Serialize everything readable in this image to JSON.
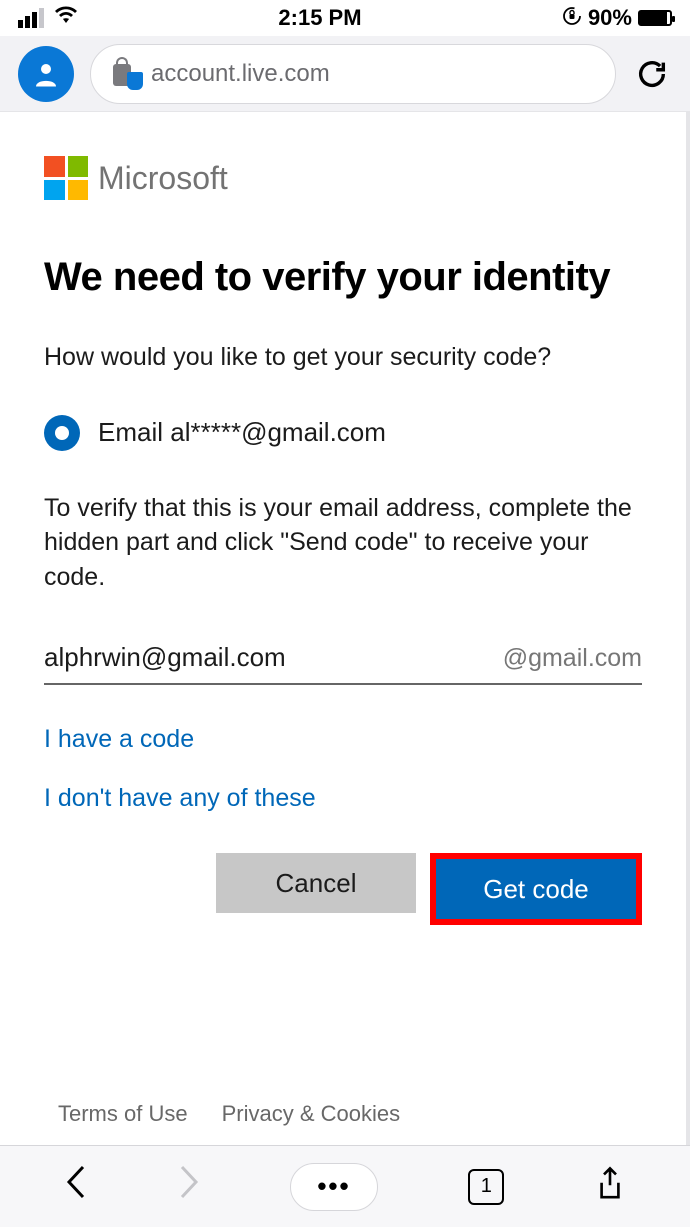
{
  "status": {
    "time": "2:15 PM",
    "battery_pct": "90%"
  },
  "browser": {
    "url": "account.live.com",
    "tab_count": "1"
  },
  "brand": {
    "name": "Microsoft"
  },
  "page": {
    "heading": "We need to verify your identity",
    "prompt": "How would you like to get your security code?",
    "radio_option": "Email al*****@gmail.com",
    "instruction": "To verify that this is your email address, complete the hidden part and click \"Send code\" to receive your code.",
    "email_input_value": "alphrwin@gmail.com",
    "email_suffix": "@gmail.com",
    "link_have_code": "I have a code",
    "link_none": "I don't have any of these",
    "btn_cancel": "Cancel",
    "btn_primary": "Get code"
  },
  "footer": {
    "terms": "Terms of Use",
    "privacy": "Privacy & Cookies"
  }
}
